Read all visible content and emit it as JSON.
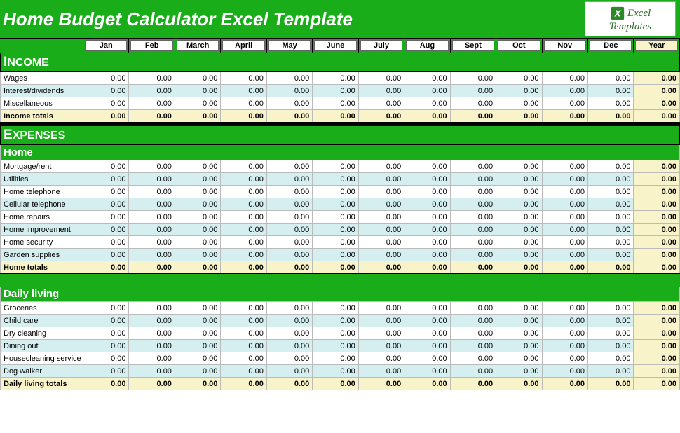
{
  "title": "Home Budget Calculator Excel Template",
  "logo": {
    "line1": "Excel",
    "line2": "Templates"
  },
  "months": [
    "Jan",
    "Feb",
    "March",
    "April",
    "May",
    "June",
    "July",
    "Aug",
    "Sept",
    "Oct",
    "Nov",
    "Dec",
    "Year"
  ],
  "sections": {
    "income": {
      "title_cap": "I",
      "title_rest": "NCOME",
      "rows": [
        {
          "label": "Wages",
          "vals": [
            "0.00",
            "0.00",
            "0.00",
            "0.00",
            "0.00",
            "0.00",
            "0.00",
            "0.00",
            "0.00",
            "0.00",
            "0.00",
            "0.00",
            "0.00"
          ]
        },
        {
          "label": "Interest/dividends",
          "vals": [
            "0.00",
            "0.00",
            "0.00",
            "0.00",
            "0.00",
            "0.00",
            "0.00",
            "0.00",
            "0.00",
            "0.00",
            "0.00",
            "0.00",
            "0.00"
          ]
        },
        {
          "label": "Miscellaneous",
          "vals": [
            "0.00",
            "0.00",
            "0.00",
            "0.00",
            "0.00",
            "0.00",
            "0.00",
            "0.00",
            "0.00",
            "0.00",
            "0.00",
            "0.00",
            "0.00"
          ]
        }
      ],
      "total": {
        "label": "Income totals",
        "vals": [
          "0.00",
          "0.00",
          "0.00",
          "0.00",
          "0.00",
          "0.00",
          "0.00",
          "0.00",
          "0.00",
          "0.00",
          "0.00",
          "0.00",
          "0.00"
        ]
      }
    },
    "expenses": {
      "title_cap": "E",
      "title_rest": "XPENSES"
    },
    "home": {
      "subtitle": "Home",
      "rows": [
        {
          "label": "Mortgage/rent",
          "vals": [
            "0.00",
            "0.00",
            "0.00",
            "0.00",
            "0.00",
            "0.00",
            "0.00",
            "0.00",
            "0.00",
            "0.00",
            "0.00",
            "0.00",
            "0.00"
          ]
        },
        {
          "label": "Utilities",
          "vals": [
            "0.00",
            "0.00",
            "0.00",
            "0.00",
            "0.00",
            "0.00",
            "0.00",
            "0.00",
            "0.00",
            "0.00",
            "0.00",
            "0.00",
            "0.00"
          ]
        },
        {
          "label": "Home telephone",
          "vals": [
            "0.00",
            "0.00",
            "0.00",
            "0.00",
            "0.00",
            "0.00",
            "0.00",
            "0.00",
            "0.00",
            "0.00",
            "0.00",
            "0.00",
            "0.00"
          ]
        },
        {
          "label": "Cellular telephone",
          "vals": [
            "0.00",
            "0.00",
            "0.00",
            "0.00",
            "0.00",
            "0.00",
            "0.00",
            "0.00",
            "0.00",
            "0.00",
            "0.00",
            "0.00",
            "0.00"
          ]
        },
        {
          "label": "Home repairs",
          "vals": [
            "0.00",
            "0.00",
            "0.00",
            "0.00",
            "0.00",
            "0.00",
            "0.00",
            "0.00",
            "0.00",
            "0.00",
            "0.00",
            "0.00",
            "0.00"
          ]
        },
        {
          "label": "Home improvement",
          "vals": [
            "0.00",
            "0.00",
            "0.00",
            "0.00",
            "0.00",
            "0.00",
            "0.00",
            "0.00",
            "0.00",
            "0.00",
            "0.00",
            "0.00",
            "0.00"
          ]
        },
        {
          "label": "Home security",
          "vals": [
            "0.00",
            "0.00",
            "0.00",
            "0.00",
            "0.00",
            "0.00",
            "0.00",
            "0.00",
            "0.00",
            "0.00",
            "0.00",
            "0.00",
            "0.00"
          ]
        },
        {
          "label": "Garden supplies",
          "vals": [
            "0.00",
            "0.00",
            "0.00",
            "0.00",
            "0.00",
            "0.00",
            "0.00",
            "0.00",
            "0.00",
            "0.00",
            "0.00",
            "0.00",
            "0.00"
          ]
        }
      ],
      "total": {
        "label": "Home totals",
        "vals": [
          "0.00",
          "0.00",
          "0.00",
          "0.00",
          "0.00",
          "0.00",
          "0.00",
          "0.00",
          "0.00",
          "0.00",
          "0.00",
          "0.00",
          "0.00"
        ]
      }
    },
    "daily": {
      "subtitle": "Daily living",
      "rows": [
        {
          "label": "Groceries",
          "vals": [
            "0.00",
            "0.00",
            "0.00",
            "0.00",
            "0.00",
            "0.00",
            "0.00",
            "0.00",
            "0.00",
            "0.00",
            "0.00",
            "0.00",
            "0.00"
          ]
        },
        {
          "label": "Child care",
          "vals": [
            "0.00",
            "0.00",
            "0.00",
            "0.00",
            "0.00",
            "0.00",
            "0.00",
            "0.00",
            "0.00",
            "0.00",
            "0.00",
            "0.00",
            "0.00"
          ]
        },
        {
          "label": "Dry cleaning",
          "vals": [
            "0.00",
            "0.00",
            "0.00",
            "0.00",
            "0.00",
            "0.00",
            "0.00",
            "0.00",
            "0.00",
            "0.00",
            "0.00",
            "0.00",
            "0.00"
          ]
        },
        {
          "label": "Dining out",
          "vals": [
            "0.00",
            "0.00",
            "0.00",
            "0.00",
            "0.00",
            "0.00",
            "0.00",
            "0.00",
            "0.00",
            "0.00",
            "0.00",
            "0.00",
            "0.00"
          ]
        },
        {
          "label": "Housecleaning service",
          "vals": [
            "0.00",
            "0.00",
            "0.00",
            "0.00",
            "0.00",
            "0.00",
            "0.00",
            "0.00",
            "0.00",
            "0.00",
            "0.00",
            "0.00",
            "0.00"
          ]
        },
        {
          "label": "Dog walker",
          "vals": [
            "0.00",
            "0.00",
            "0.00",
            "0.00",
            "0.00",
            "0.00",
            "0.00",
            "0.00",
            "0.00",
            "0.00",
            "0.00",
            "0.00",
            "0.00"
          ]
        }
      ],
      "total": {
        "label": "Daily living totals",
        "vals": [
          "0.00",
          "0.00",
          "0.00",
          "0.00",
          "0.00",
          "0.00",
          "0.00",
          "0.00",
          "0.00",
          "0.00",
          "0.00",
          "0.00",
          "0.00"
        ]
      }
    }
  }
}
